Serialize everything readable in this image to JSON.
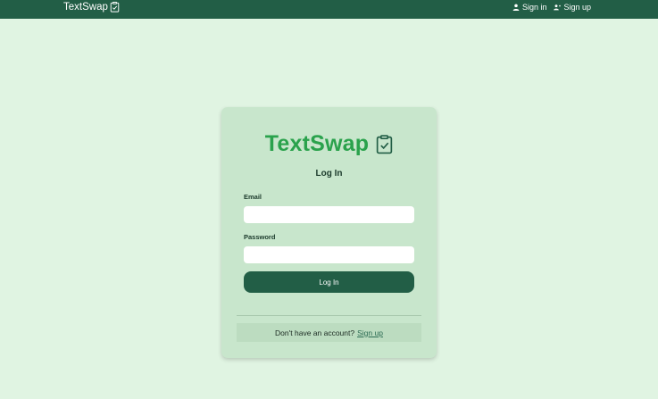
{
  "colors": {
    "navbar": "#225e46",
    "background": "#e0f4e2",
    "card": "#c8e6cc",
    "logo_green": "#2aa24c",
    "button": "#225e46"
  },
  "navbar": {
    "brand": "TextSwap",
    "brand_icon": "clipboard-check-icon",
    "sign_in_label": "Sign in",
    "sign_in_icon": "user-icon",
    "sign_up_label": "Sign up",
    "sign_up_icon": "user-plus-icon"
  },
  "login_card": {
    "logo_text": "TextSwap",
    "logo_icon": "clipboard-check-icon",
    "title": "Log In",
    "email_label": "Email",
    "email_value": "",
    "password_label": "Password",
    "password_value": "",
    "submit_label": "Log In",
    "footer_text": "Don't have an account?",
    "footer_link": "Sign up"
  }
}
